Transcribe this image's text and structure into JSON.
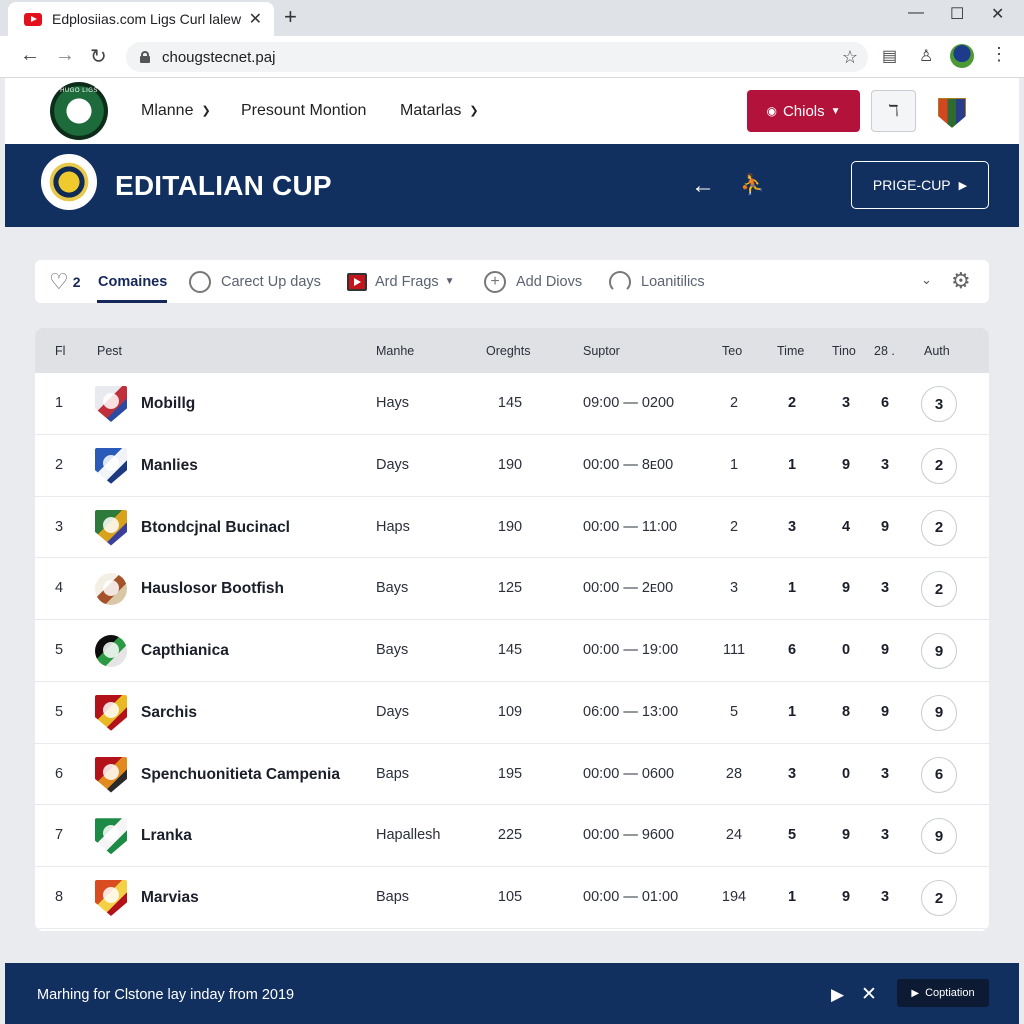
{
  "browser": {
    "tab_title": "Edplosiias.com Ligs Curl lalew",
    "tab_close": "✕",
    "new_tab": "+",
    "url": "chougstecnet.paj",
    "window_controls": [
      "—",
      "☐",
      "✕"
    ]
  },
  "site_header": {
    "logo_text": "HUGO LIGS",
    "nav": [
      {
        "label": "Mlanne",
        "has_dropdown": true
      },
      {
        "label": "Presount Montion",
        "has_dropdown": false
      },
      {
        "label": "Matarlas",
        "has_dropdown": true
      }
    ],
    "primary_button": "Chiols",
    "tuner_icon": "ℸ"
  },
  "hero": {
    "title": "EDITALIAN CUP",
    "cta_label": "PRIGE-CUP"
  },
  "filters": {
    "heart_count": "2",
    "items": [
      {
        "label": "Comaines",
        "icon": "heart-icon",
        "active": true
      },
      {
        "label": "Carect Up days",
        "icon": "circle-icon",
        "active": false
      },
      {
        "label": "Ard Frags",
        "icon": "youtube-icon",
        "active": false,
        "has_dropdown": true
      },
      {
        "label": "Add Diovs",
        "icon": "plus-circle-icon",
        "active": false
      },
      {
        "label": "Loanitilics",
        "icon": "gauge-icon",
        "active": false
      }
    ]
  },
  "table": {
    "columns": [
      "Fl",
      "Pest",
      "Manhe",
      "Oreghts",
      "Suptor",
      "Teo",
      "Time",
      "Tino",
      "28 .",
      "Auth"
    ],
    "rows": [
      {
        "pos": "1",
        "team": "Mobillg",
        "manhe": "Hays",
        "oreghts": "145",
        "suptor": "09:00 — 0200",
        "teo": "2",
        "time": "2",
        "tino": "3",
        "c28": "6",
        "auth": "3",
        "crest_colors": [
          "#e9e9f0",
          "#c0303a",
          "#2b4aa0"
        ],
        "crest_shape": "shield"
      },
      {
        "pos": "2",
        "team": "Manlies",
        "manhe": "Days",
        "oreghts": "190",
        "suptor": "00:00 — 8ᴇ00",
        "teo": "1",
        "time": "1",
        "tino": "9",
        "c28": "3",
        "auth": "2",
        "crest_colors": [
          "#2a5bb8",
          "#f1f3f7",
          "#1b3a80"
        ],
        "crest_shape": "shield"
      },
      {
        "pos": "3",
        "team": "Btondcjnal Bucinacl",
        "manhe": "Haps",
        "oreghts": "190",
        "suptor": "00:00 — 11:00",
        "teo": "2",
        "time": "3",
        "tino": "4",
        "c28": "9",
        "auth": "2",
        "crest_colors": [
          "#2e7a3a",
          "#d9a21c",
          "#3a3f9c"
        ],
        "crest_shape": "shield"
      },
      {
        "pos": "4",
        "team": "Hauslosor Bootfish",
        "manhe": "Bays",
        "oreghts": "125",
        "suptor": "00:00 — 2ᴇ00",
        "teo": "3",
        "time": "1",
        "tino": "9",
        "c28": "3",
        "auth": "2",
        "crest_colors": [
          "#f4efe4",
          "#a5522a",
          "#d9c8a8"
        ],
        "crest_shape": "round"
      },
      {
        "pos": "5",
        "team": "Capthianica",
        "manhe": "Bays",
        "oreghts": "145",
        "suptor": "00:00 — 19:00",
        "teo": "111",
        "time": "6",
        "tino": "0",
        "c28": "9",
        "auth": "9",
        "crest_colors": [
          "#0d0d0d",
          "#2c9a44",
          "#e5e5e5"
        ],
        "crest_shape": "round"
      },
      {
        "pos": "5",
        "team": "Sarchis",
        "manhe": "Days",
        "oreghts": "109",
        "suptor": "06:00 — 13:00",
        "teo": "5",
        "time": "1",
        "tino": "8",
        "c28": "9",
        "auth": "9",
        "crest_colors": [
          "#b3121b",
          "#e8b925",
          "#b3121b"
        ],
        "crest_shape": "shield"
      },
      {
        "pos": "6",
        "team": "Spenchuonitieta Campenia",
        "manhe": "Baps",
        "oreghts": "195",
        "suptor": "00:00 — 0600",
        "teo": "28",
        "time": "3",
        "tino": "0",
        "c28": "3",
        "auth": "6",
        "crest_colors": [
          "#b3121b",
          "#e08a1f",
          "#2a2a2a"
        ],
        "crest_shape": "shield"
      },
      {
        "pos": "7",
        "team": "Lranka",
        "manhe": "Hapallesh",
        "oreghts": "225",
        "suptor": "00:00 — 9600",
        "teo": "24",
        "time": "5",
        "tino": "9",
        "c28": "3",
        "auth": "9",
        "crest_colors": [
          "#1d8a45",
          "#f5f5f5",
          "#1d8a45"
        ],
        "crest_shape": "shield"
      },
      {
        "pos": "8",
        "team": "Marvias",
        "manhe": "Baps",
        "oreghts": "105",
        "suptor": "00:00 — 01:00",
        "teo": "194",
        "time": "1",
        "tino": "9",
        "c28": "3",
        "auth": "2",
        "crest_colors": [
          "#d94c1f",
          "#f3d046",
          "#b3121b"
        ],
        "crest_shape": "shield"
      }
    ]
  },
  "footer": {
    "text": "Marhing for Clstone lay inday from  2019",
    "button_label": "Coptiation"
  },
  "colors": {
    "navy": "#12305f",
    "accent_red": "#b3123a",
    "header_row": "#dfe1e5"
  }
}
